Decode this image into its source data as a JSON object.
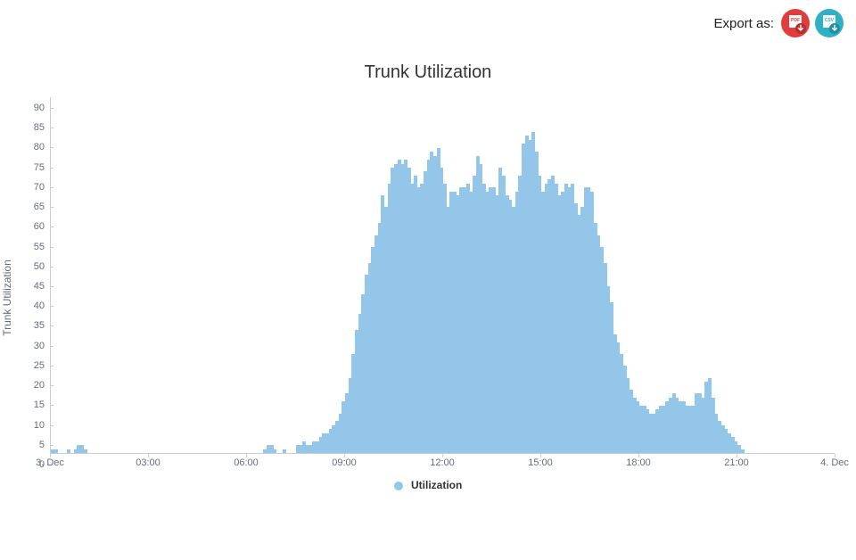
{
  "export": {
    "label": "Export as:",
    "pdf_name": "PDF",
    "csv_name": "CSV",
    "pdf_color": "#e23c3c",
    "csv_color": "#2fb0c4"
  },
  "chart_data": {
    "type": "area",
    "title": "Trunk Utilization",
    "ylabel": "Trunk Utilization",
    "xlabel": "",
    "ylim": [
      0,
      90
    ],
    "y_ticks": [
      0,
      5,
      10,
      15,
      20,
      25,
      30,
      35,
      40,
      45,
      50,
      55,
      60,
      65,
      70,
      75,
      80,
      85,
      90
    ],
    "x_tick_labels": [
      "3. Dec",
      "03:00",
      "06:00",
      "09:00",
      "12:00",
      "15:00",
      "18:00",
      "21:00",
      "4. Dec"
    ],
    "x_tick_positions_hours": [
      0,
      3,
      6,
      9,
      12,
      15,
      18,
      21,
      24
    ],
    "legend": [
      "Utilization"
    ],
    "series": [
      {
        "name": "Utilization",
        "color": "#93c6e8",
        "x_hours": [
          0.0,
          0.1,
          0.2,
          0.3,
          0.4,
          0.5,
          0.6,
          0.7,
          0.8,
          0.9,
          1.0,
          1.1,
          1.2,
          1.3,
          1.4,
          1.5,
          1.6,
          1.7,
          1.8,
          1.9,
          2.0,
          2.1,
          2.2,
          2.3,
          2.4,
          2.5,
          2.6,
          2.7,
          2.8,
          2.9,
          3.0,
          3.1,
          3.2,
          3.3,
          3.4,
          3.5,
          3.6,
          3.7,
          3.8,
          3.9,
          4.0,
          4.1,
          4.2,
          4.3,
          4.4,
          4.5,
          4.6,
          4.7,
          4.8,
          4.9,
          5.0,
          5.1,
          5.2,
          5.3,
          5.4,
          5.5,
          5.6,
          5.7,
          5.8,
          5.9,
          6.0,
          6.1,
          6.2,
          6.3,
          6.4,
          6.5,
          6.6,
          6.7,
          6.8,
          6.9,
          7.0,
          7.1,
          7.2,
          7.3,
          7.4,
          7.5,
          7.6,
          7.7,
          7.8,
          7.9,
          8.0,
          8.1,
          8.2,
          8.3,
          8.4,
          8.5,
          8.6,
          8.7,
          8.8,
          8.9,
          9.0,
          9.1,
          9.2,
          9.3,
          9.4,
          9.5,
          9.6,
          9.7,
          9.8,
          9.9,
          10.0,
          10.1,
          10.2,
          10.3,
          10.4,
          10.5,
          10.6,
          10.7,
          10.8,
          10.9,
          11.0,
          11.1,
          11.2,
          11.3,
          11.4,
          11.5,
          11.6,
          11.7,
          11.8,
          11.9,
          12.0,
          12.1,
          12.2,
          12.3,
          12.4,
          12.5,
          12.6,
          12.7,
          12.8,
          12.9,
          13.0,
          13.1,
          13.2,
          13.3,
          13.4,
          13.5,
          13.6,
          13.7,
          13.8,
          13.9,
          14.0,
          14.1,
          14.2,
          14.3,
          14.4,
          14.5,
          14.6,
          14.7,
          14.8,
          14.9,
          15.0,
          15.1,
          15.2,
          15.3,
          15.4,
          15.5,
          15.6,
          15.7,
          15.8,
          15.9,
          16.0,
          16.1,
          16.2,
          16.3,
          16.4,
          16.5,
          16.6,
          16.7,
          16.8,
          16.9,
          17.0,
          17.1,
          17.2,
          17.3,
          17.4,
          17.5,
          17.6,
          17.7,
          17.8,
          17.9,
          18.0,
          18.1,
          18.2,
          18.3,
          18.4,
          18.5,
          18.6,
          18.7,
          18.8,
          18.9,
          19.0,
          19.1,
          19.2,
          19.3,
          19.4,
          19.5,
          19.6,
          19.7,
          19.8,
          19.9,
          20.0,
          20.1,
          20.2,
          20.3,
          20.4,
          20.5,
          20.6,
          20.7,
          20.8,
          20.9,
          21.0,
          21.1,
          21.2,
          21.3,
          21.4,
          21.5,
          21.6,
          21.7,
          21.8,
          21.9,
          22.0,
          22.1,
          22.2,
          22.3,
          22.4,
          22.5,
          22.6,
          22.7,
          22.8,
          22.9,
          23.0,
          23.1,
          23.2,
          23.3,
          23.4,
          23.5,
          23.6,
          23.7,
          23.8,
          23.9
        ],
        "values": [
          1,
          1,
          0,
          0,
          0,
          1,
          0,
          1,
          2,
          2,
          1,
          0,
          0,
          0,
          0,
          0,
          0,
          0,
          0,
          0,
          0,
          0,
          0,
          0,
          0,
          0,
          0,
          0,
          0,
          0,
          0,
          0,
          0,
          0,
          0,
          0,
          0,
          0,
          0,
          0,
          0,
          0,
          0,
          0,
          0,
          0,
          0,
          0,
          0,
          0,
          0,
          0,
          0,
          0,
          0,
          0,
          0,
          0,
          0,
          0,
          0,
          0,
          0,
          0,
          0,
          1,
          2,
          2,
          1,
          0,
          0,
          1,
          0,
          0,
          0,
          2,
          2,
          3,
          2,
          2,
          3,
          3,
          4,
          5,
          5,
          6,
          7,
          8,
          10,
          13,
          15,
          19,
          25,
          31,
          35,
          40,
          45,
          48,
          52,
          55,
          58,
          65,
          62,
          68,
          72,
          73,
          74,
          73,
          74,
          72,
          68,
          70,
          67,
          68,
          71,
          74,
          76,
          75,
          77,
          72,
          68,
          62,
          66,
          66,
          65,
          67,
          67,
          68,
          66,
          70,
          75,
          73,
          68,
          66,
          67,
          67,
          65,
          72,
          70,
          65,
          64,
          62,
          66,
          70,
          78,
          80,
          79,
          81,
          76,
          70,
          66,
          68,
          69,
          70,
          68,
          65,
          66,
          68,
          67,
          68,
          63,
          60,
          62,
          67,
          67,
          66,
          58,
          55,
          52,
          48,
          42,
          38,
          30,
          28,
          25,
          22,
          19,
          16,
          14,
          13,
          12,
          12,
          11,
          10,
          10,
          11,
          12,
          12,
          13,
          14,
          15,
          14,
          13,
          13,
          12,
          12,
          12,
          15,
          15,
          14,
          18,
          19,
          14,
          10,
          8,
          7,
          6,
          5,
          4,
          3,
          2,
          1,
          0,
          0,
          0,
          0,
          0,
          0,
          0,
          0,
          0,
          0,
          0,
          0,
          0,
          0,
          0,
          0,
          0,
          0,
          0,
          0,
          0,
          0,
          0,
          0,
          0,
          0,
          0,
          0
        ]
      }
    ]
  }
}
